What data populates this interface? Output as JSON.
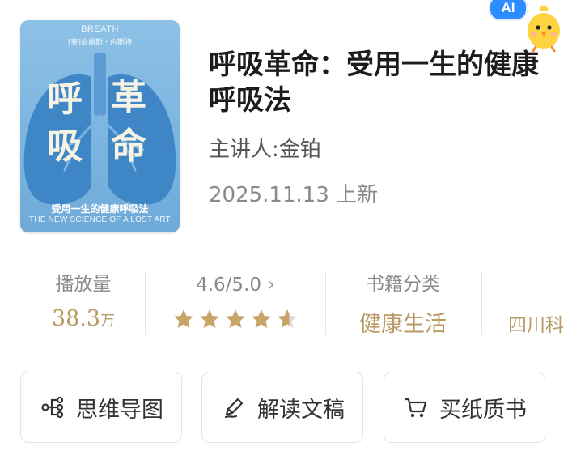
{
  "book": {
    "cover": {
      "en_top": "BREATH",
      "author_line": "[美]詹姆斯・内斯特",
      "title_chars": [
        "呼",
        "吸",
        "革",
        "命"
      ],
      "subtitle": "受用一生的健康呼吸法",
      "en_bottom": "THE NEW SCIENCE OF A LOST ART",
      "colors": {
        "background": "#7ab4e0",
        "lung": "#3f86c6",
        "title": "#f6f2e4"
      }
    },
    "title": "呼吸革命：受用一生的健康呼吸法",
    "presenter": "主讲人:金铂",
    "date": "2025.11.13 上新"
  },
  "ai_badge": {
    "label": "AI",
    "mascot_icon": "chick-mascot-icon"
  },
  "stats": {
    "plays": {
      "label": "播放量",
      "value": "38.3",
      "unit": "万"
    },
    "rating": {
      "label": "4.6/5.0",
      "chevron": "›",
      "stars": 4.6,
      "max": 5
    },
    "category": {
      "label": "书籍分类",
      "value": "健康生活"
    },
    "publisher": {
      "value": "四川科"
    }
  },
  "actions": [
    {
      "label": "思维导图",
      "icon": "mindmap-icon"
    },
    {
      "label": "解读文稿",
      "icon": "pen-icon"
    },
    {
      "label": "买纸质书",
      "icon": "cart-icon"
    }
  ],
  "colors": {
    "accent_gold": "#b89a63",
    "star_gold": "#c9a46a",
    "text_gray": "#8a8a8a"
  }
}
